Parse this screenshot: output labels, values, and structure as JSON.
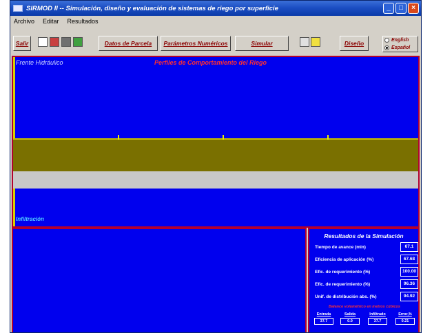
{
  "window": {
    "title": "SIRMOD II -- Simulación, diseño y evaluación de sistemas de riego por superficie"
  },
  "menu": [
    "Archivo",
    "Editar",
    "Resultados"
  ],
  "toolbar": {
    "salir": "Salir",
    "datos_parcela": "Datos de Parcela",
    "parametros": "Parámetros Numéricos",
    "simular": "Simular",
    "diseno": "Diseño",
    "lang_english": "English",
    "lang_espanol": "Español"
  },
  "canvas": {
    "label_left": "Frente Hidráulico",
    "label_center": "Perfiles de Comportamiento del Riego",
    "label_infiltration": "Infiltración"
  },
  "results": {
    "title": "Resultados de la Simulación",
    "rows": [
      {
        "label": "Tiempo de avance (min)",
        "value": "67.1"
      },
      {
        "label": "Eficiencia de aplicación (%)",
        "value": "67.68"
      },
      {
        "label": "Efic. de requerimiento (%)",
        "value": "100.00"
      },
      {
        "label": "Efic. de requerimiento (%)",
        "value": "96.36"
      },
      {
        "label": "Unif. de distribución abs. (%)",
        "value": "94.92"
      }
    ],
    "stats_title": "Balance volumétrico en metros cúbicos",
    "stats": [
      {
        "label": "Entrada",
        "value": "37.7"
      },
      {
        "label": "Salida",
        "value": "0.0"
      },
      {
        "label": "Infiltrado",
        "value": "37.7"
      },
      {
        "label": "Error,%",
        "value": "0.21"
      }
    ]
  }
}
